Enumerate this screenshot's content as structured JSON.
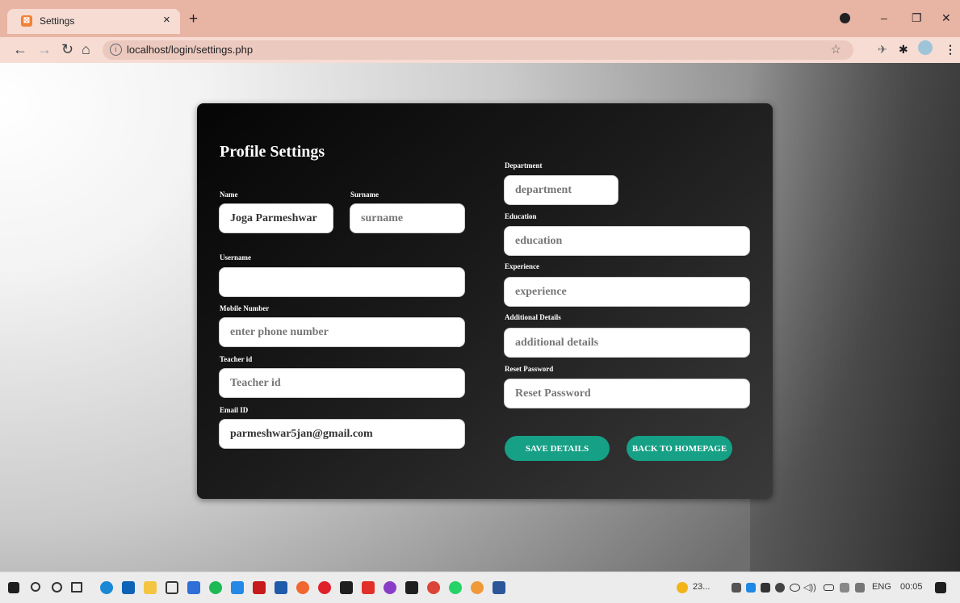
{
  "browser": {
    "tab_title": "Settings",
    "tab_close": "×",
    "new_tab": "+",
    "url": "localhost/login/settings.php",
    "controls": {
      "minimize": "–",
      "maximize": "❐",
      "close": "✕"
    }
  },
  "card": {
    "title": "Profile Settings",
    "fields": {
      "name": {
        "label": "Name",
        "value": "Joga Parmeshwar",
        "placeholder": ""
      },
      "surname": {
        "label": "Surname",
        "value": "",
        "placeholder": "surname"
      },
      "username": {
        "label": "Username",
        "value": "",
        "placeholder": ""
      },
      "mobile": {
        "label": "Mobile Number",
        "value": "",
        "placeholder": "enter phone number"
      },
      "teacher_id": {
        "label": "Teacher id",
        "value": "",
        "placeholder": "Teacher id"
      },
      "email": {
        "label": "Email ID",
        "value": "parmeshwar5jan@gmail.com",
        "placeholder": ""
      },
      "department": {
        "label": "Department",
        "value": "",
        "placeholder": "department"
      },
      "education": {
        "label": "Education",
        "value": "",
        "placeholder": "education"
      },
      "experience": {
        "label": "Experience",
        "value": "",
        "placeholder": "experience"
      },
      "additional": {
        "label": "Additional Details",
        "value": "",
        "placeholder": "additional details"
      },
      "reset_password": {
        "label": "Reset Password",
        "value": "",
        "placeholder": "Reset Password"
      }
    },
    "buttons": {
      "save": "SAVE DETAILS",
      "back": "BACK TO HOMEPAGE"
    }
  },
  "taskbar": {
    "weather": "23...",
    "language": "ENG",
    "time": "00:05"
  },
  "colors": {
    "accent": "#16a085",
    "tabstrip": "#e8b4a4",
    "toolbar": "#f6dcd3"
  }
}
